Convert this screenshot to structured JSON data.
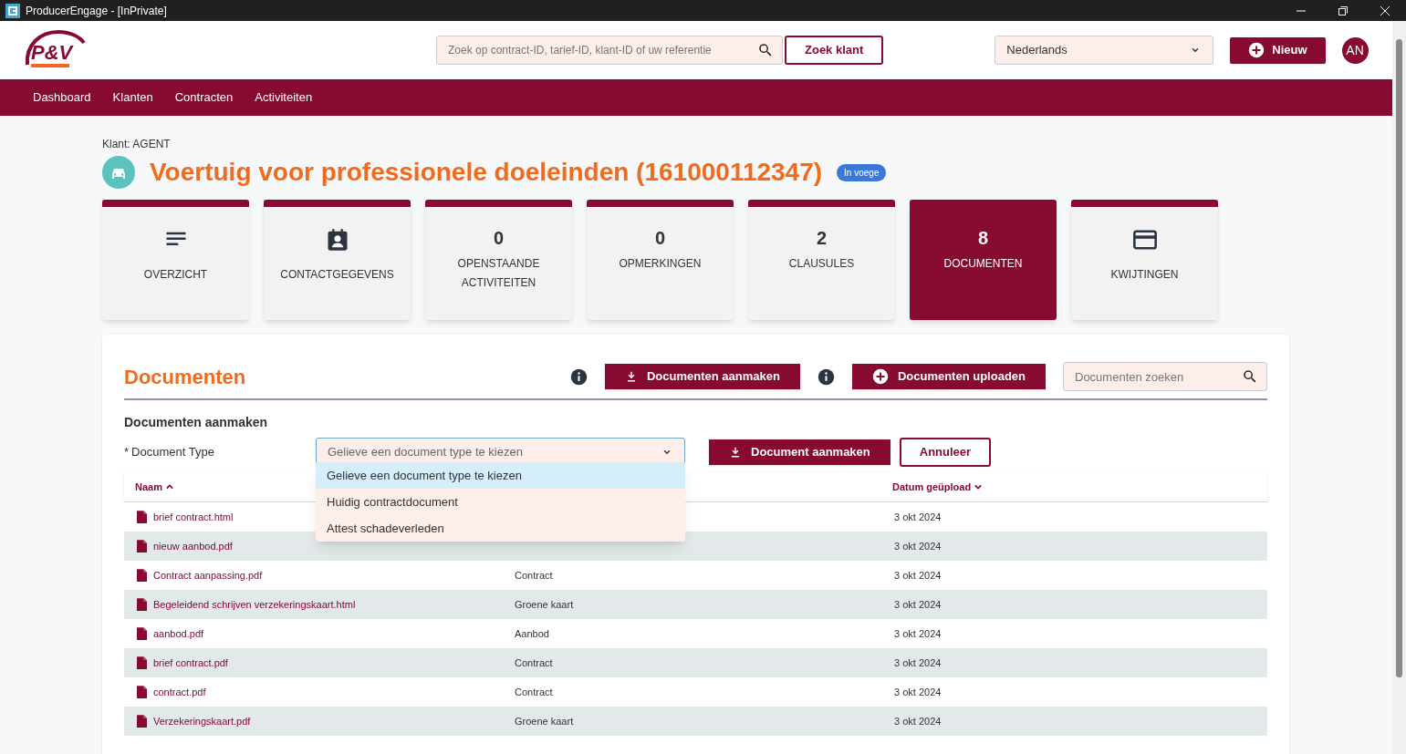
{
  "window": {
    "title": "ProducerEngage - [InPrivate]"
  },
  "logo_text": "P&V",
  "header": {
    "search_placeholder": "Zoek op contract-ID, tarief-ID, klant-ID of uw referentie",
    "search_button": "Zoek klant",
    "language": "Nederlands",
    "new_button": "Nieuw",
    "avatar": "AN"
  },
  "nav": [
    "Dashboard",
    "Klanten",
    "Contracten",
    "Activiteiten"
  ],
  "client_label": "Klant: AGENT",
  "page_title": "Voertuig voor professionele doeleinden (161000112347)",
  "status_badge": "In voege",
  "tiles": [
    {
      "kind": "icon",
      "label": "OVERZICHT",
      "selected": false
    },
    {
      "kind": "icon",
      "label": "CONTACTGEGEVENS",
      "selected": false
    },
    {
      "kind": "count",
      "count": "0",
      "label": "OPENSTAANDE ACTIVITEITEN",
      "selected": false
    },
    {
      "kind": "count",
      "count": "0",
      "label": "OPMERKINGEN",
      "selected": false
    },
    {
      "kind": "count",
      "count": "2",
      "label": "CLAUSULES",
      "selected": false
    },
    {
      "kind": "count",
      "count": "8",
      "label": "DOCUMENTEN",
      "selected": true
    },
    {
      "kind": "icon",
      "label": "KWIJTINGEN",
      "selected": false
    }
  ],
  "documents": {
    "title": "Documenten",
    "create_button": "Documenten aanmaken",
    "upload_button": "Documenten uploaden",
    "search_placeholder": "Documenten zoeken",
    "form": {
      "title": "Documenten aanmaken",
      "required_mark": "*",
      "field_label": "Document Type",
      "placeholder": "Gelieve een document type te kiezen",
      "submit": "Document aanmaken",
      "cancel": "Annuleer",
      "options": [
        {
          "label": "Gelieve een document type te kiezen",
          "selected": true
        },
        {
          "label": "Huidig contractdocument",
          "selected": false
        },
        {
          "label": "Attest schadeverleden",
          "selected": false
        }
      ]
    },
    "table": {
      "columns": [
        "Naam",
        "Datum geüpload"
      ],
      "rows": [
        {
          "name": "brief contract.html",
          "date": "3 okt 2024"
        },
        {
          "name": "nieuw aanbod.pdf",
          "date": "3 okt 2024"
        },
        {
          "name": "Contract aanpassing.pdf",
          "type": "Contract",
          "date": "3 okt 2024"
        },
        {
          "name": "Begeleidend schrijven verzekeringskaart.html",
          "type": "Groene kaart",
          "date": "3 okt 2024"
        },
        {
          "name": "aanbod.pdf",
          "type": "Aanbod",
          "date": "3 okt 2024"
        },
        {
          "name": "brief contract.pdf",
          "type": "Contract",
          "date": "3 okt 2024"
        },
        {
          "name": "contract.pdf",
          "type": "Contract",
          "date": "3 okt 2024"
        },
        {
          "name": "Verzekeringskaart.pdf",
          "type": "Groene kaart",
          "date": "3 okt 2024"
        }
      ]
    }
  }
}
